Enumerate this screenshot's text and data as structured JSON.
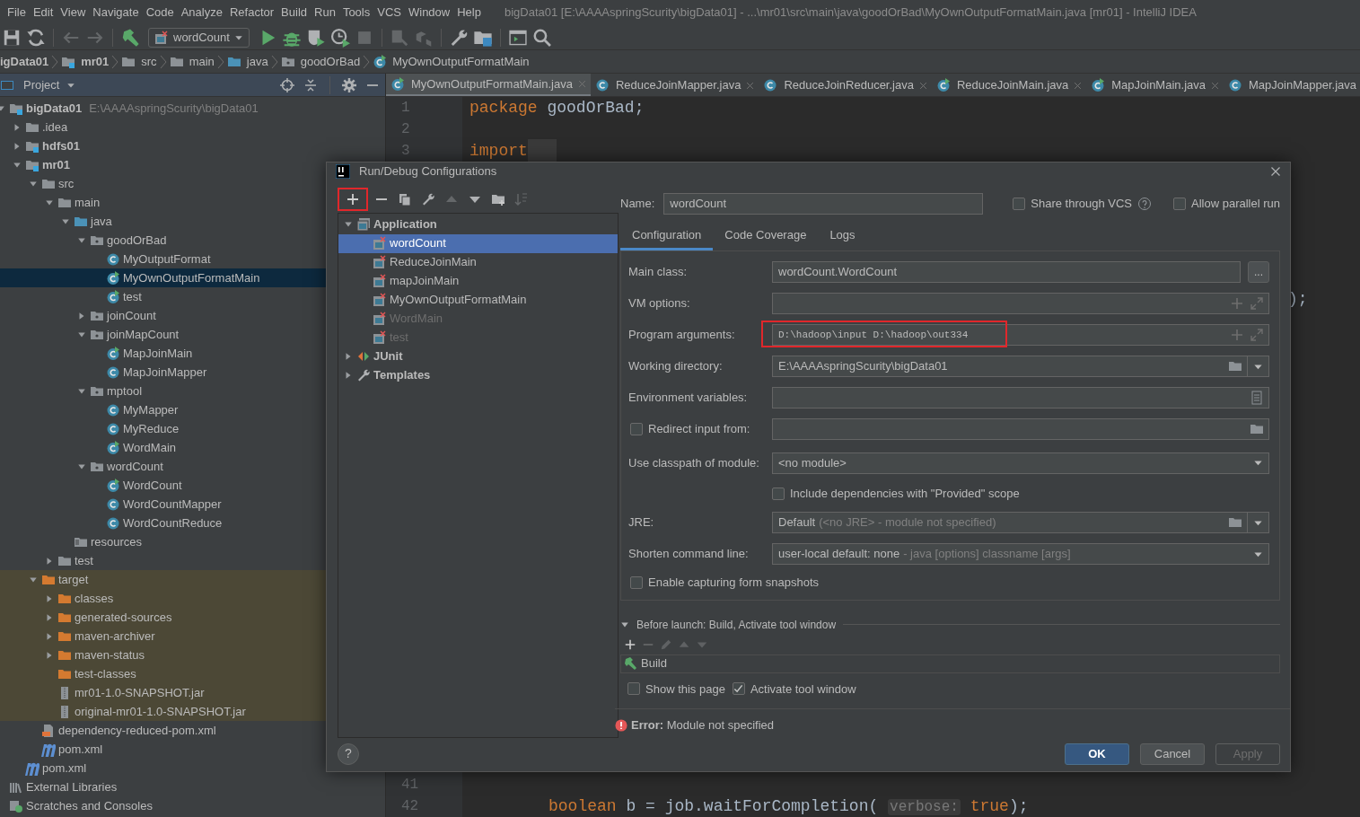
{
  "menu": {
    "items": [
      "File",
      "Edit",
      "View",
      "Navigate",
      "Code",
      "Analyze",
      "Refactor",
      "Build",
      "Run",
      "Tools",
      "VCS",
      "Window",
      "Help"
    ],
    "title": "bigData01 [E:\\AAAAspringScurity\\bigData01] - ...\\mr01\\src\\main\\java\\goodOrBad\\MyOwnOutputFormatMain.java [mr01] - IntelliJ IDEA"
  },
  "toolbar": [
    {
      "kind": "save",
      "disabled": false
    },
    {
      "kind": "sync",
      "disabled": false
    },
    {
      "kind": "sep"
    },
    {
      "kind": "back",
      "disabled": true
    },
    {
      "kind": "forward",
      "disabled": true
    },
    {
      "kind": "sep"
    },
    {
      "kind": "build",
      "disabled": false
    },
    {
      "kind": "config",
      "label": "wordCount"
    },
    {
      "kind": "run",
      "disabled": false
    },
    {
      "kind": "debug",
      "disabled": false
    },
    {
      "kind": "coverage",
      "disabled": false
    },
    {
      "kind": "profile",
      "disabled": false
    },
    {
      "kind": "stop",
      "disabled": true
    },
    {
      "kind": "sep"
    },
    {
      "kind": "update",
      "disabled": true
    },
    {
      "kind": "deploy",
      "disabled": true
    },
    {
      "kind": "sep"
    },
    {
      "kind": "wrench",
      "disabled": false
    },
    {
      "kind": "structure",
      "disabled": false
    },
    {
      "kind": "sep"
    },
    {
      "kind": "window",
      "disabled": false
    },
    {
      "kind": "search",
      "disabled": false
    }
  ],
  "breadcrumb": [
    {
      "label": "igData01",
      "kind": "module-cut",
      "bold": true
    },
    {
      "label": "mr01",
      "kind": "module",
      "bold": true
    },
    {
      "label": "src",
      "kind": "folder",
      "bold": false
    },
    {
      "label": "main",
      "kind": "folder",
      "bold": false
    },
    {
      "label": "java",
      "kind": "source",
      "bold": false
    },
    {
      "label": "goodOrBad",
      "kind": "package",
      "bold": false
    },
    {
      "label": "MyOwnOutputFormatMain",
      "kind": "class-main",
      "bold": false
    }
  ],
  "project_panel": {
    "title": "Project",
    "tree": [
      {
        "label": "bigData01",
        "path": "E:\\AAAAspringScurity\\bigData01",
        "kind": "module",
        "bold": true,
        "selected": false,
        "expanded": true,
        "children": [
          {
            "label": ".idea",
            "kind": "folder",
            "bold": false,
            "selected": false,
            "expanded": false
          },
          {
            "label": "hdfs01",
            "kind": "module",
            "bold": true,
            "selected": false,
            "expanded": false
          },
          {
            "label": "mr01",
            "kind": "module",
            "bold": true,
            "selected": false,
            "expanded": true,
            "children": [
              {
                "label": "src",
                "kind": "folder",
                "bold": false,
                "selected": false,
                "expanded": true,
                "children": [
                  {
                    "label": "main",
                    "kind": "folder",
                    "bold": false,
                    "selected": false,
                    "expanded": true,
                    "children": [
                      {
                        "label": "java",
                        "kind": "source",
                        "bold": false,
                        "selected": false,
                        "expanded": true,
                        "children": [
                          {
                            "label": "goodOrBad",
                            "kind": "package",
                            "bold": false,
                            "selected": false,
                            "expanded": true,
                            "children": [
                              {
                                "label": "MyOutputFormat",
                                "kind": "class",
                                "bold": false,
                                "selected": false
                              },
                              {
                                "label": "MyOwnOutputFormatMain",
                                "kind": "class-main",
                                "bold": false,
                                "selected": true
                              },
                              {
                                "label": "test",
                                "kind": "class-main",
                                "bold": false,
                                "selected": false
                              }
                            ]
                          },
                          {
                            "label": "joinCount",
                            "kind": "package",
                            "bold": false,
                            "selected": false,
                            "expanded": false
                          },
                          {
                            "label": "joinMapCount",
                            "kind": "package",
                            "bold": false,
                            "selected": false,
                            "expanded": true,
                            "children": [
                              {
                                "label": "MapJoinMain",
                                "kind": "class-main",
                                "bold": false,
                                "selected": false
                              },
                              {
                                "label": "MapJoinMapper",
                                "kind": "class",
                                "bold": false,
                                "selected": false
                              }
                            ]
                          },
                          {
                            "label": "mptool",
                            "kind": "package",
                            "bold": false,
                            "selected": false,
                            "expanded": true,
                            "children": [
                              {
                                "label": "MyMapper",
                                "kind": "class",
                                "bold": false,
                                "selected": false
                              },
                              {
                                "label": "MyReduce",
                                "kind": "class",
                                "bold": false,
                                "selected": false
                              },
                              {
                                "label": "WordMain",
                                "kind": "class-main",
                                "bold": false,
                                "selected": false
                              }
                            ]
                          },
                          {
                            "label": "wordCount",
                            "kind": "package",
                            "bold": false,
                            "selected": false,
                            "expanded": true,
                            "children": [
                              {
                                "label": "WordCount",
                                "kind": "class-main",
                                "bold": false,
                                "selected": false
                              },
                              {
                                "label": "WordCountMapper",
                                "kind": "class",
                                "bold": false,
                                "selected": false
                              },
                              {
                                "label": "WordCountReduce",
                                "kind": "class",
                                "bold": false,
                                "selected": false
                              }
                            ]
                          }
                        ]
                      },
                      {
                        "label": "resources",
                        "kind": "resources",
                        "bold": false,
                        "selected": false
                      }
                    ]
                  },
                  {
                    "label": "test",
                    "kind": "folder",
                    "bold": false,
                    "selected": false,
                    "expanded": false
                  }
                ]
              },
              {
                "label": "target",
                "kind": "excluded",
                "bold": false,
                "selected": false,
                "excluded": true,
                "expanded": true,
                "children": [
                  {
                    "label": "classes",
                    "kind": "excluded",
                    "bold": false,
                    "selected": false,
                    "excluded": true,
                    "expanded": false
                  },
                  {
                    "label": "generated-sources",
                    "kind": "excluded",
                    "bold": false,
                    "selected": false,
                    "excluded": true,
                    "expanded": false
                  },
                  {
                    "label": "maven-archiver",
                    "kind": "excluded",
                    "bold": false,
                    "selected": false,
                    "excluded": true,
                    "expanded": false
                  },
                  {
                    "label": "maven-status",
                    "kind": "excluded",
                    "bold": false,
                    "selected": false,
                    "excluded": true,
                    "expanded": false
                  },
                  {
                    "label": "test-classes",
                    "kind": "excluded",
                    "bold": false,
                    "selected": false,
                    "excluded": true
                  },
                  {
                    "label": "mr01-1.0-SNAPSHOT.jar",
                    "kind": "jar",
                    "bold": false,
                    "selected": false,
                    "excluded": true
                  },
                  {
                    "label": "original-mr01-1.0-SNAPSHOT.jar",
                    "kind": "jar",
                    "bold": false,
                    "selected": false,
                    "excluded": true
                  }
                ]
              },
              {
                "label": "dependency-reduced-pom.xml",
                "kind": "xml",
                "bold": false,
                "selected": false
              },
              {
                "label": "pom.xml",
                "kind": "maven",
                "bold": false,
                "selected": false
              }
            ]
          },
          {
            "label": "pom.xml",
            "kind": "maven",
            "bold": false,
            "selected": false
          }
        ]
      },
      {
        "label": "External Libraries",
        "kind": "libraries",
        "bold": false,
        "selected": false
      },
      {
        "label": "Scratches and Consoles",
        "kind": "scratches",
        "bold": false,
        "selected": false
      }
    ]
  },
  "editor": {
    "tabs": [
      {
        "label": "MyOwnOutputFormatMain.java",
        "kind": "class-main",
        "selected": true,
        "closable": true
      },
      {
        "label": "ReduceJoinMapper.java",
        "kind": "class",
        "selected": false,
        "closable": true
      },
      {
        "label": "ReduceJoinReducer.java",
        "kind": "class",
        "selected": false,
        "closable": true
      },
      {
        "label": "ReduceJoinMain.java",
        "kind": "class-main",
        "selected": false,
        "closable": true
      },
      {
        "label": "MapJoinMain.java",
        "kind": "class-main",
        "selected": false,
        "closable": true
      },
      {
        "label": "MapJoinMapper.java",
        "kind": "class",
        "selected": false,
        "closable": false
      }
    ],
    "lines": [
      {
        "number": "1",
        "tokens": [
          {
            "kind": "keyword",
            "text": "package"
          },
          {
            "kind": "plain",
            "text": " goodOrBad;"
          }
        ]
      },
      {
        "number": "2"
      },
      {
        "number": "3",
        "tokens": [
          {
            "kind": "keyword",
            "text": "import"
          },
          {
            "kind": "fold"
          }
        ]
      }
    ],
    "fragment": ");",
    "bottom_lines": [
      {
        "number": "41"
      },
      {
        "number": "42",
        "tokens": [
          {
            "kind": "keyword",
            "text": "boolean"
          },
          {
            "kind": "plain",
            "text": " b = job.waitForCompletion( "
          },
          {
            "kind": "hint",
            "text": "verbose:"
          },
          {
            "kind": "keyword",
            "text": " true"
          },
          {
            "kind": "plain",
            "text": ");"
          }
        ]
      }
    ]
  },
  "dialog": {
    "title": "Run/Debug Configurations",
    "tools": [
      {
        "kind": "add",
        "disabled": false,
        "highlighted": true
      },
      {
        "kind": "remove",
        "disabled": false,
        "highlighted": false
      },
      {
        "kind": "copy",
        "disabled": false,
        "highlighted": false
      },
      {
        "kind": "wrench",
        "disabled": false,
        "highlighted": false
      },
      {
        "kind": "up",
        "disabled": true,
        "highlighted": false
      },
      {
        "kind": "down",
        "disabled": false,
        "highlighted": false
      },
      {
        "kind": "folder",
        "disabled": false,
        "highlighted": false
      },
      {
        "kind": "sort",
        "disabled": true,
        "highlighted": false
      }
    ],
    "tree": [
      {
        "label": "Application",
        "kind": "application",
        "bold": true,
        "selected": false,
        "greyed": false,
        "expanded": true,
        "children": [
          {
            "label": "wordCount",
            "kind": "config",
            "bold": false,
            "selected": true,
            "greyed": false
          },
          {
            "label": "ReduceJoinMain",
            "kind": "config",
            "bold": false,
            "selected": false,
            "greyed": false
          },
          {
            "label": "mapJoinMain",
            "kind": "config",
            "bold": false,
            "selected": false,
            "greyed": false
          },
          {
            "label": "MyOwnOutputFormatMain",
            "kind": "config",
            "bold": false,
            "selected": false,
            "greyed": false
          },
          {
            "label": "WordMain",
            "kind": "config",
            "bold": false,
            "selected": false,
            "greyed": true
          },
          {
            "label": "test",
            "kind": "config",
            "bold": false,
            "selected": false,
            "greyed": true
          }
        ]
      },
      {
        "label": "JUnit",
        "kind": "junit",
        "bold": true,
        "selected": false,
        "greyed": false,
        "expanded": false
      },
      {
        "label": "Templates",
        "kind": "templates",
        "bold": true,
        "selected": false,
        "greyed": false,
        "expanded": false
      }
    ],
    "help_button": "?",
    "name_label": "Name:",
    "name_value": "wordCount",
    "options": [
      {
        "label": "Share through VCS",
        "checked": false,
        "help": true
      },
      {
        "label": "Allow parallel run",
        "checked": false,
        "help": false
      }
    ],
    "tabs": [
      {
        "label": "Configuration",
        "selected": true
      },
      {
        "label": "Code Coverage",
        "selected": false
      },
      {
        "label": "Logs",
        "selected": false
      }
    ],
    "rows": [
      {
        "kind": "class",
        "label": "Main class:",
        "value": "wordCount.WordCount",
        "button": "..."
      },
      {
        "kind": "expand",
        "label": "VM options:",
        "highlighted": false
      },
      {
        "kind": "expand",
        "label": "Program arguments:",
        "value": "D:\\hadoop\\input D:\\hadoop\\out334",
        "highlighted": true
      },
      {
        "kind": "path",
        "label": "Working directory:",
        "value": "E:\\AAAAspringScurity\\bigData01"
      },
      {
        "kind": "env",
        "label": "Environment variables:"
      },
      {
        "kind": "redirect",
        "label": "Redirect input from:",
        "checked": false
      },
      {
        "kind": "select",
        "label": "Use classpath of module:",
        "value": "<no module>"
      },
      {
        "kind": "check",
        "label": "Include dependencies with \"Provided\" scope",
        "checked": false
      },
      {
        "kind": "jre",
        "label": "JRE:",
        "value": "Default",
        "hint": "(<no JRE> - module not specified)"
      },
      {
        "kind": "shorten",
        "label": "Shorten command line:",
        "value": "user-local default: none",
        "hint": "- java [options] classname [args]"
      },
      {
        "kind": "check-left",
        "label": "Enable capturing form snapshots",
        "checked": false
      }
    ],
    "before_launch": {
      "title": "Before launch: Build, Activate tool window",
      "expanded": true,
      "tools": [
        {
          "kind": "add",
          "disabled": false
        },
        {
          "kind": "remove",
          "disabled": true
        },
        {
          "kind": "edit",
          "disabled": true
        },
        {
          "kind": "up",
          "disabled": true
        },
        {
          "kind": "down",
          "disabled": true
        }
      ],
      "tasks": [
        "Build"
      ],
      "checks": [
        {
          "label": "Show this page",
          "checked": false
        },
        {
          "label": "Activate tool window",
          "checked": true
        }
      ]
    },
    "error": "**Error:** Module not specified",
    "buttons": [
      {
        "label": "OK",
        "kind": "primary",
        "disabled": false
      },
      {
        "label": "Cancel",
        "kind": "default",
        "disabled": false
      },
      {
        "label": "Apply",
        "kind": "default",
        "disabled": true
      }
    ]
  }
}
